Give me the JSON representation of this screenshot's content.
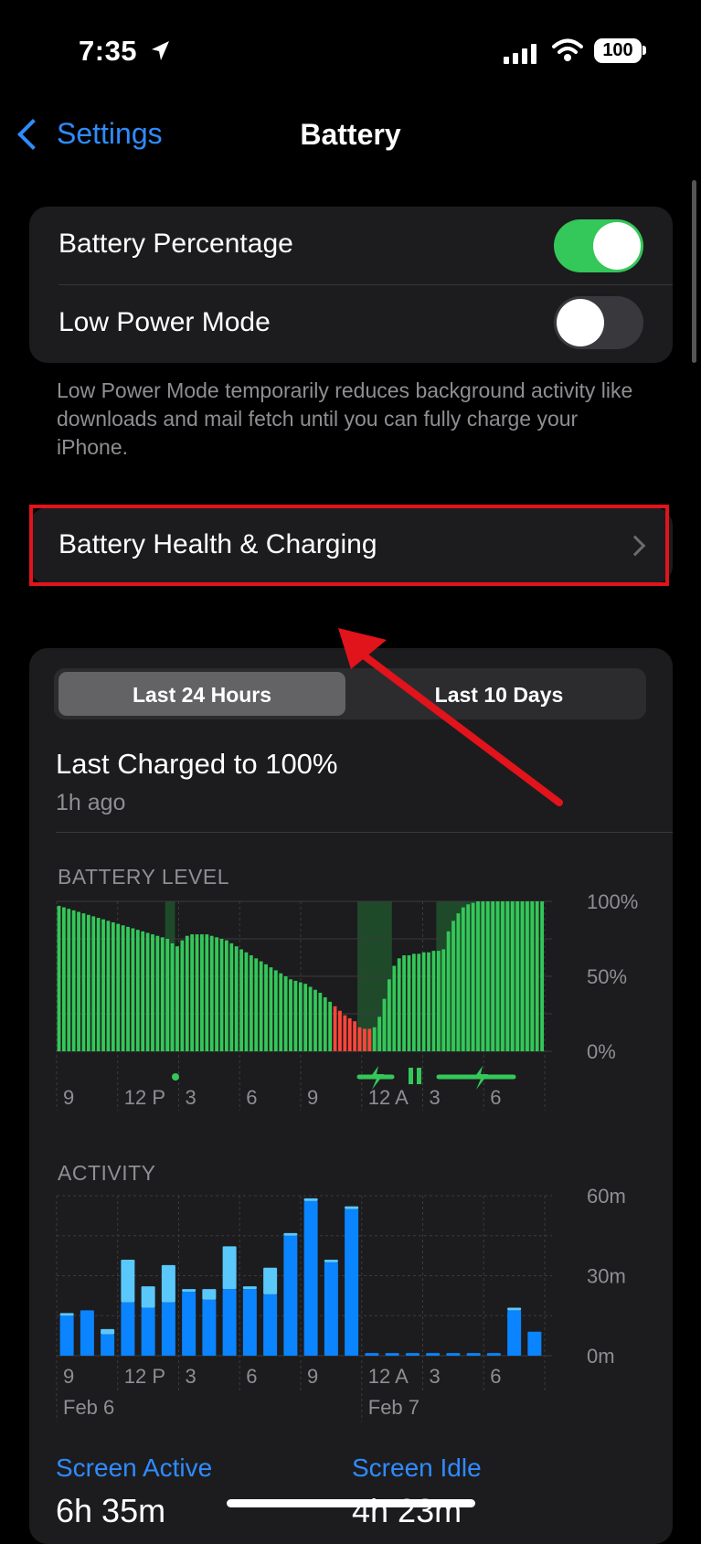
{
  "status_bar": {
    "time": "7:35",
    "battery": "100"
  },
  "nav": {
    "back_label": "Settings",
    "title": "Battery"
  },
  "settings": {
    "battery_percentage": {
      "label": "Battery Percentage",
      "on": true
    },
    "low_power_mode": {
      "label": "Low Power Mode",
      "on": false
    },
    "footnote": "Low Power Mode temporarily reduces background activity like downloads and mail fetch until you can fully charge your iPhone.",
    "health_row": "Battery Health & Charging"
  },
  "usage": {
    "tabs": [
      "Last 24 Hours",
      "Last 10 Days"
    ],
    "selected_tab": 0,
    "last_charged_title": "Last Charged to 100%",
    "last_charged_time": "1h ago",
    "battery_level_title": "BATTERY LEVEL",
    "activity_title": "ACTIVITY",
    "summary": [
      {
        "label": "Screen Active",
        "value": "6h 35m"
      },
      {
        "label": "Screen Idle",
        "value": "4h 23m"
      }
    ]
  },
  "colors": {
    "accent": "#2f8bff",
    "green": "#34c759",
    "red": "#ff453a",
    "highlight": "#e1131b"
  },
  "chart_data": [
    {
      "type": "bar",
      "title": "BATTERY LEVEL",
      "x_tick_labels": [
        "9",
        "12 P",
        "3",
        "6",
        "9",
        "12 A",
        "3",
        "6"
      ],
      "y_tick_labels": [
        "100%",
        "50%",
        "0%"
      ],
      "ylim": [
        0,
        100
      ],
      "values": [
        97,
        96,
        95,
        94,
        93,
        92,
        91,
        90,
        89,
        88,
        87,
        86,
        85,
        84,
        83,
        82,
        81,
        80,
        79,
        78,
        77,
        76,
        75,
        72,
        70,
        74,
        77,
        78,
        78,
        78,
        78,
        77,
        76,
        75,
        74,
        72,
        70,
        68,
        66,
        64,
        62,
        60,
        58,
        56,
        54,
        52,
        50,
        48,
        47,
        46,
        45,
        43,
        41,
        39,
        36,
        33,
        30,
        27,
        24,
        22,
        20,
        16,
        15,
        15,
        16,
        23,
        35,
        48,
        57,
        62,
        64,
        64,
        65,
        65,
        66,
        66,
        67,
        67,
        68,
        80,
        87,
        92,
        96,
        98,
        99,
        100,
        100,
        100,
        100,
        100,
        100,
        100,
        100,
        100,
        100,
        100,
        100,
        100,
        100
      ],
      "low_indices": [
        56,
        57,
        58,
        59,
        60,
        61,
        62,
        63
      ],
      "charging_bands": [
        {
          "from": 22,
          "to": 23
        },
        {
          "from": 61,
          "to": 67
        },
        {
          "from": 77,
          "to": 96
        }
      ]
    },
    {
      "type": "bar",
      "title": "ACTIVITY",
      "x_tick_labels": [
        "9",
        "12 P",
        "3",
        "6",
        "9",
        "12 A",
        "3",
        "6"
      ],
      "date_labels": [
        "Feb 6",
        "Feb 7"
      ],
      "y_tick_labels": [
        "60m",
        "30m",
        "0m"
      ],
      "ylim": [
        0,
        60
      ],
      "series": [
        {
          "name": "Screen Active",
          "values": [
            15,
            17,
            8,
            20,
            18,
            20,
            24,
            21,
            25,
            25,
            23,
            45,
            58,
            35,
            55,
            1,
            1,
            1,
            1,
            1,
            1,
            1,
            17,
            9
          ]
        },
        {
          "name": "Screen Idle",
          "values": [
            1,
            0,
            2,
            16,
            8,
            14,
            1,
            4,
            16,
            1,
            10,
            1,
            1,
            1,
            1,
            0,
            0,
            0,
            0,
            0,
            0,
            0,
            1,
            0
          ]
        }
      ]
    }
  ]
}
